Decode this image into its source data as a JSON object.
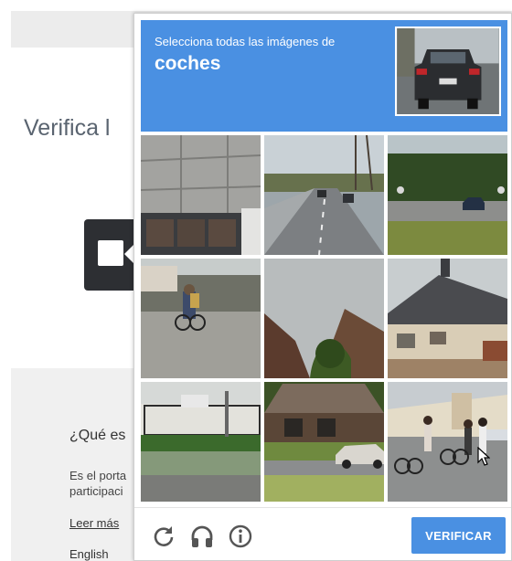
{
  "background_page": {
    "heading": "Verifica l",
    "info_title": "¿Qué es",
    "info_text_line1": "Es el porta",
    "info_text_line2": "participaci",
    "read_more_link": "Leer más",
    "language": "English"
  },
  "captcha": {
    "instruction": "Selecciona todas las imágenes de",
    "target": "coches",
    "sample_image": "car-rear-view-photo",
    "tiles": [
      {
        "label": "building-wall-photo"
      },
      {
        "label": "highway-with-cars-photo"
      },
      {
        "label": "road-with-car-and-trees-photo"
      },
      {
        "label": "cyclist-on-sidewalk-photo"
      },
      {
        "label": "rooftops-and-tree-photo"
      },
      {
        "label": "house-with-roof-photo"
      },
      {
        "label": "fence-and-parking-photo"
      },
      {
        "label": "car-in-front-of-building-photo"
      },
      {
        "label": "cyclists-and-pedestrians-photo"
      }
    ],
    "footer": {
      "reload_icon": "reload-icon",
      "audio_icon": "headphones-icon",
      "info_icon": "info-icon",
      "verify_label": "VERIFICAR"
    }
  },
  "colors": {
    "accent": "#4a90e2",
    "dark_box": "#2d2f33"
  }
}
